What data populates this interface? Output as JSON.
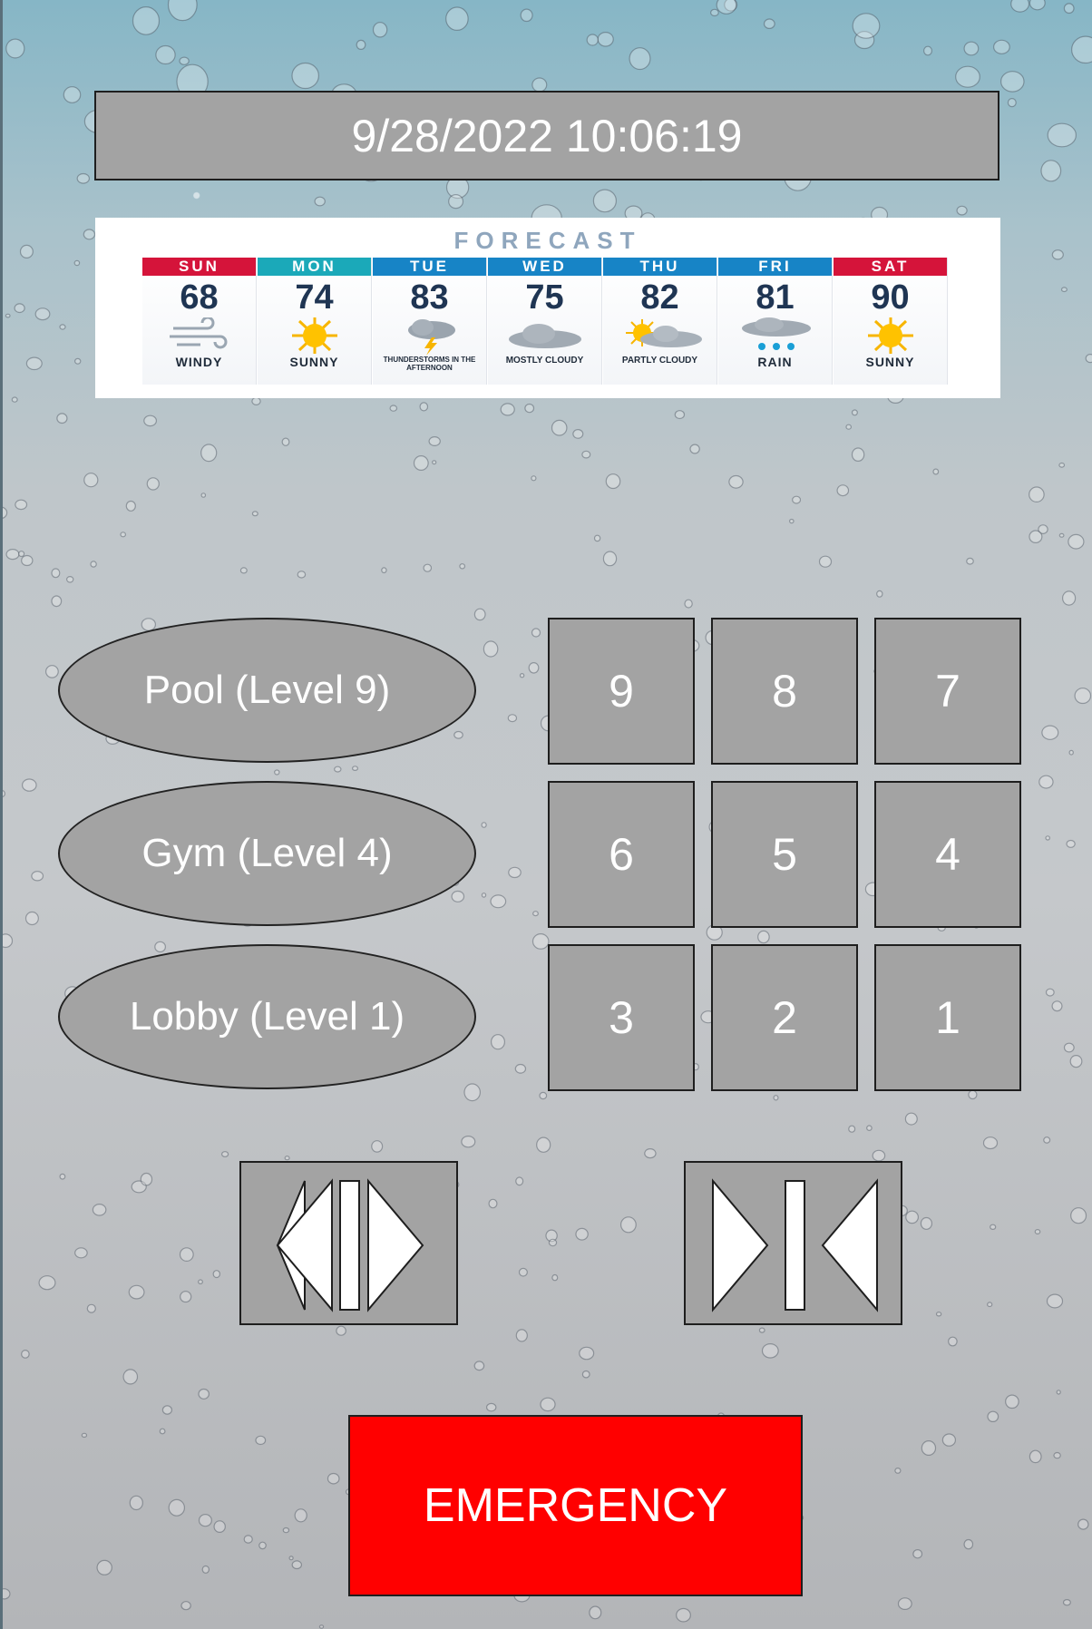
{
  "datetime": "9/28/2022 10:06:19",
  "forecast": {
    "title": "FORECAST",
    "days": [
      {
        "day": "SUN",
        "temp": "68",
        "condition": "WINDY",
        "icon": "wind-icon",
        "head_color": "#d5143a"
      },
      {
        "day": "MON",
        "temp": "74",
        "condition": "SUNNY",
        "icon": "sun-icon",
        "head_color": "#1ba9b9"
      },
      {
        "day": "TUE",
        "temp": "83",
        "condition": "THUNDERSTORMS IN THE AFTERNOON",
        "icon": "thunderstorm-icon",
        "head_color": "#1784c6"
      },
      {
        "day": "WED",
        "temp": "75",
        "condition": "MOSTLY CLOUDY",
        "icon": "cloud-icon",
        "head_color": "#1784c6"
      },
      {
        "day": "THU",
        "temp": "82",
        "condition": "PARTLY CLOUDY",
        "icon": "partly-cloudy-icon",
        "head_color": "#1784c6"
      },
      {
        "day": "FRI",
        "temp": "81",
        "condition": "RAIN",
        "icon": "rain-icon",
        "head_color": "#1784c6"
      },
      {
        "day": "SAT",
        "temp": "90",
        "condition": "SUNNY",
        "icon": "sun-icon",
        "head_color": "#d5143a"
      }
    ]
  },
  "shortcuts": {
    "pool": "Pool (Level 9)",
    "gym": "Gym (Level 4)",
    "lobby": "Lobby (Level 1)"
  },
  "floors": [
    "9",
    "8",
    "7",
    "6",
    "5",
    "4",
    "3",
    "2",
    "1"
  ],
  "doors": {
    "open_icon": "door-open-icon",
    "close_icon": "door-close-icon"
  },
  "emergency_label": "EMERGENCY",
  "colors": {
    "button_gray": "#a3a3a3",
    "emergency_red": "#ff0000",
    "text_white": "#ffffff"
  }
}
